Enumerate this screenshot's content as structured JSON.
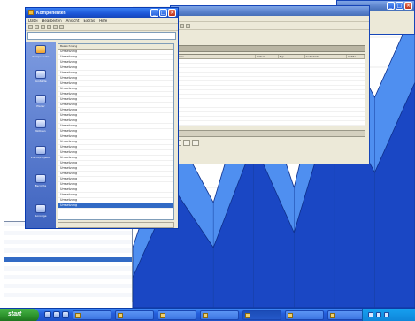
{
  "colors": {
    "chart_dark": "#1a47c4",
    "chart_mid": "#2f6ae0",
    "chart_light": "#4f8ff0",
    "xp_blue": "#245edb",
    "start_green": "#2a8f2a"
  },
  "front_window": {
    "title": "Komponenten",
    "menu": [
      "Datei",
      "Bearbeiten",
      "Ansicht",
      "Extras",
      "Hilfe"
    ],
    "address": "",
    "sidebar_items": [
      {
        "label": "Komponente",
        "icon": "folder-icon"
      },
      {
        "label": "Kontakte",
        "icon": "contacts-icon"
      },
      {
        "label": "Planer",
        "icon": "calendar-icon"
      },
      {
        "label": "Notizen",
        "icon": "notes-icon"
      },
      {
        "label": "Pflicht/Projekte",
        "icon": "tasks-icon"
      },
      {
        "label": "Berichte",
        "icon": "report-icon"
      },
      {
        "label": "Sonstige",
        "icon": "misc-icon"
      }
    ],
    "list_header": "Bezeichnung",
    "rows": [
      "Umsetzung",
      "Umsetzung",
      "Umsetzung",
      "Umsetzung",
      "Umsetzung",
      "Umsetzung",
      "Umsetzung",
      "Umsetzung",
      "Umsetzung",
      "Umsetzung",
      "Umsetzung",
      "Umsetzung",
      "Umsetzung",
      "Umsetzung",
      "Umsetzung",
      "Umsetzung",
      "Umsetzung",
      "Umsetzung",
      "Umsetzung",
      "Umsetzung",
      "Umsetzung",
      "Umsetzung",
      "Umsetzung",
      "Umsetzung",
      "Umsetzung",
      "Umsetzung",
      "Umsetzung",
      "Umsetzung",
      "Umsetzung",
      "Umsetzung"
    ],
    "selected_row": 29,
    "status": ""
  },
  "back_window": {
    "title": "",
    "columns": [
      "Name",
      "Datum",
      "Typ",
      "Geändert",
      "Größe"
    ],
    "rows": [
      [
        "",
        "",
        "",
        "",
        ""
      ],
      [
        "",
        "",
        "",
        "",
        ""
      ],
      [
        "",
        "",
        "",
        "",
        ""
      ],
      [
        "",
        "",
        "",
        "",
        ""
      ],
      [
        "",
        "",
        "",
        "",
        ""
      ],
      [
        "",
        "",
        "",
        "",
        ""
      ],
      [
        "",
        "",
        "",
        "",
        ""
      ],
      [
        "",
        "",
        "",
        "",
        ""
      ],
      [
        "",
        "",
        "",
        "",
        ""
      ],
      [
        "",
        "",
        "",
        "",
        ""
      ],
      [
        "",
        "",
        "",
        "",
        ""
      ],
      [
        "",
        "",
        "",
        "",
        ""
      ],
      [
        "",
        "",
        "",
        "",
        ""
      ],
      [
        "",
        "",
        "",
        "",
        ""
      ],
      [
        "",
        "",
        "",
        "",
        ""
      ]
    ],
    "tabs": [
      "",
      "",
      ""
    ]
  },
  "left_list": {
    "rows": [
      "",
      "",
      "",
      "",
      "",
      "",
      "",
      "",
      "",
      "",
      "",
      "",
      "",
      "",
      "",
      "",
      ""
    ],
    "selected_row": 8
  },
  "taskbar": {
    "start_label": "start",
    "buttons": [
      "",
      "",
      "",
      "",
      "",
      "",
      ""
    ],
    "active_button": 4,
    "clock": ""
  },
  "chart_data": {
    "type": "area",
    "x": [
      0,
      1,
      2,
      3,
      4,
      5,
      6,
      7
    ],
    "series": [
      {
        "values": [
          20,
          60,
          35,
          80,
          40,
          95,
          70,
          100
        ]
      },
      {
        "values": [
          10,
          40,
          20,
          55,
          25,
          70,
          45,
          75
        ]
      }
    ]
  }
}
